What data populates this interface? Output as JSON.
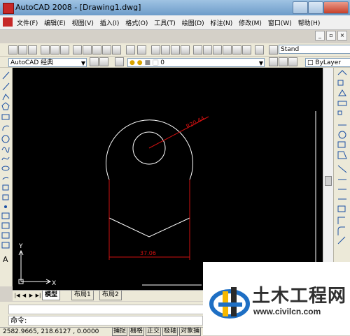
{
  "window": {
    "title": "AutoCAD 2008 - [Drawing1.dwg]"
  },
  "menu": {
    "items": [
      "文件(F)",
      "编辑(E)",
      "视图(V)",
      "插入(I)",
      "格式(O)",
      "工具(T)",
      "绘图(D)",
      "标注(N)",
      "修改(M)",
      "窗口(W)",
      "帮助(H)"
    ]
  },
  "toolbar2": {
    "workspace": "AutoCAD 经典",
    "layer": "0",
    "color": "ByLayer",
    "textstyle": "Stand"
  },
  "drawing": {
    "dim_radial": "R20.44",
    "dim_linear": "37.06"
  },
  "ucs": {
    "x_label": "X",
    "y_label": "Y"
  },
  "tabs": {
    "model": "模型",
    "layout1": "布局1",
    "layout2": "布局2"
  },
  "command": {
    "prompt": "命令:"
  },
  "status": {
    "coords": "2582.9665, 218.6127 , 0.0000",
    "buttons": [
      "捕捉",
      "栅格",
      "正交",
      "极轴",
      "对象捕"
    ]
  },
  "watermark": {
    "name": "土木工程网",
    "url": "www.civilcn.com"
  },
  "colors": {
    "canvas_bg": "#000000",
    "geometry": "#ffffff",
    "dimension": "#d01010",
    "accent_blue": "#1e6fc4"
  }
}
